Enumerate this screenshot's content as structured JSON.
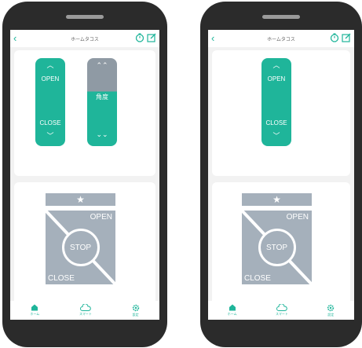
{
  "colors": {
    "accent": "#1fb59a",
    "gray": "#a5b0bb",
    "phone": "#2b2b2b"
  },
  "phones": [
    {
      "title": "ホームタコス",
      "panel_open": "OPEN",
      "panel_close": "CLOSE",
      "angle_label": "角度",
      "star": "★",
      "big_open": "OPEN",
      "big_stop": "STOP",
      "big_close": "CLOSE",
      "nav": [
        "ホーム",
        "スマート",
        "設定"
      ]
    },
    {
      "title": "ホームタコス",
      "panel_open": "OPEN",
      "panel_close": "CLOSE",
      "star": "★",
      "big_open": "OPEN",
      "big_stop": "STOP",
      "big_close": "CLOSE",
      "nav": [
        "ホーム",
        "スマート",
        "設定"
      ]
    }
  ]
}
